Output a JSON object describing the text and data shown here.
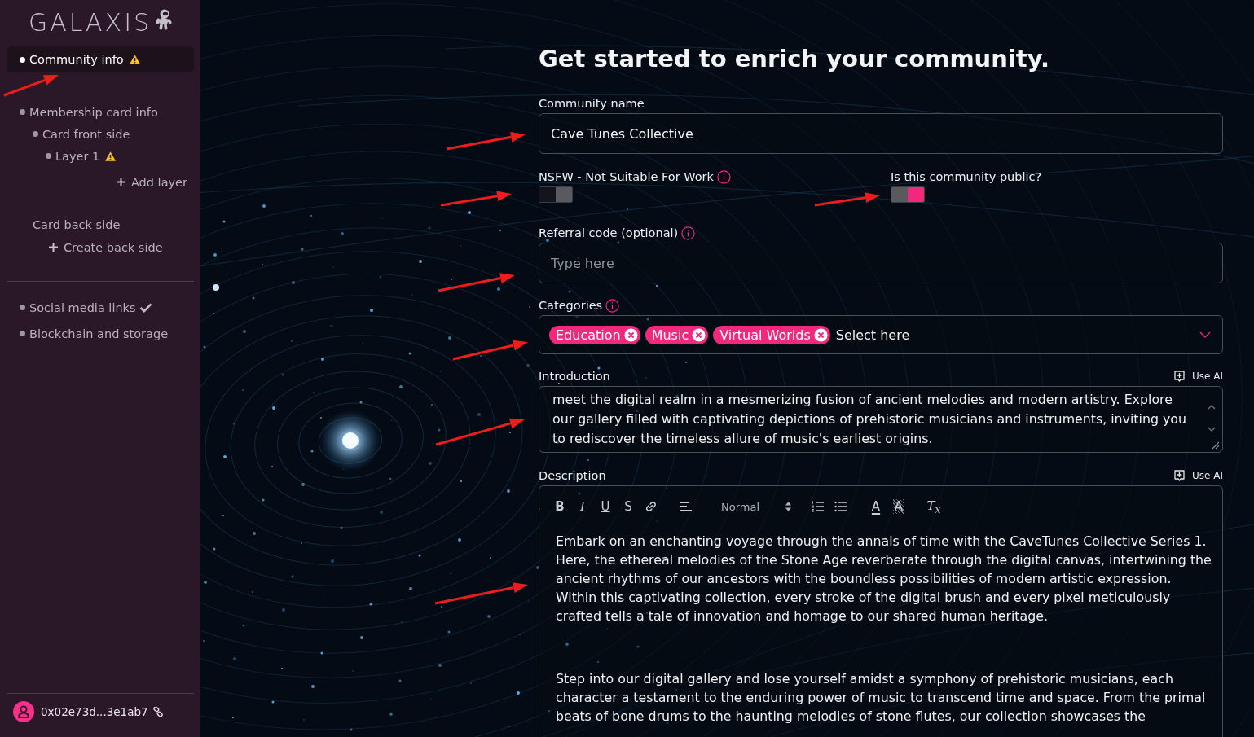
{
  "sidebar": {
    "logo": "GALAXIS",
    "sections": [
      [
        {
          "kind": "step",
          "label": "Community info",
          "selected": true,
          "warning": true,
          "complete": false
        }
      ],
      [
        {
          "kind": "step",
          "label": "Membership card info",
          "selected": false,
          "warning": false,
          "complete": false,
          "children": [
            {
              "kind": "step",
              "label": "Card front side",
              "selected": false,
              "warning": false,
              "complete": false,
              "children": [
                {
                  "kind": "step",
                  "label": "Layer 1",
                  "selected": false,
                  "warning": true,
                  "complete": false
                },
                {
                  "kind": "add-right",
                  "label": "Add layer"
                }
              ]
            },
            {
              "kind": "heading",
              "label": "Card back side",
              "children": [
                {
                  "kind": "add",
                  "label": "Create back side"
                }
              ]
            }
          ]
        }
      ],
      [
        {
          "kind": "step",
          "label": "Social media links",
          "selected": false,
          "warning": false,
          "complete": true
        },
        {
          "kind": "step",
          "label": "Blockchain and storage",
          "selected": false,
          "warning": false,
          "complete": false
        }
      ]
    ],
    "user": {
      "address": "0x02e73d...3e1ab7"
    }
  },
  "form": {
    "title": "Get started to enrich your community.",
    "community_name": {
      "label": "Community name",
      "value": "Cave Tunes Collective"
    },
    "toggles": [
      {
        "label": "NSFW - Not Suitable For Work",
        "info": true,
        "on": false
      },
      {
        "label": "Is this community public?",
        "info": false,
        "on": true
      }
    ],
    "referral": {
      "label": "Referral code (optional)",
      "info": true,
      "placeholder": "Type here"
    },
    "categories": {
      "label": "Categories",
      "info": true,
      "chips": [
        "Education",
        "Music",
        "Virtual Worlds"
      ],
      "placeholder": "Select here"
    },
    "introduction": {
      "label": "Introduction",
      "ai_button": "Use AI",
      "value": "meet the digital realm in a mesmerizing fusion of ancient melodies and modern artistry. Explore our gallery filled with captivating depictions of prehistoric musicians and instruments, inviting you to rediscover the timeless allure of music's earliest origins."
    },
    "description": {
      "label": "Description",
      "ai_button": "Use AI",
      "toolbar": [
        [
          {
            "kind": "bold",
            "label": "B"
          },
          {
            "kind": "italic",
            "label": "I"
          },
          {
            "kind": "underline",
            "label": "U"
          },
          {
            "kind": "strike",
            "label": "S"
          },
          {
            "kind": "link"
          }
        ],
        [
          {
            "kind": "align"
          }
        ],
        [
          {
            "kind": "select",
            "label": "Normal"
          }
        ],
        [
          {
            "kind": "ordered-list"
          },
          {
            "kind": "bullet-list"
          }
        ],
        [
          {
            "kind": "color",
            "label": "A"
          },
          {
            "kind": "background",
            "label": "A"
          }
        ],
        [
          {
            "kind": "clean",
            "label": "T$_{x}$"
          }
        ]
      ],
      "paragraphs": [
        "Embark on an enchanting voyage through the annals of time with the CaveTunes Collective Series 1. Here, the ethereal melodies of the Stone Age reverberate through the digital canvas, intertwining the ancient rhythms of our ancestors with the boundless possibilities of modern artistic expression. Within this captivating collection, every stroke of the digital brush and every pixel meticulously crafted tells a tale of innovation and homage to our shared human heritage.",
        "Step into our digital gallery and lose yourself amidst a symphony of prehistoric musicians, each character a testament to the enduring power of music to transcend time and space. From the primal beats of bone drums to the haunting melodies of stone flutes, our collection showcases the"
      ]
    }
  }
}
